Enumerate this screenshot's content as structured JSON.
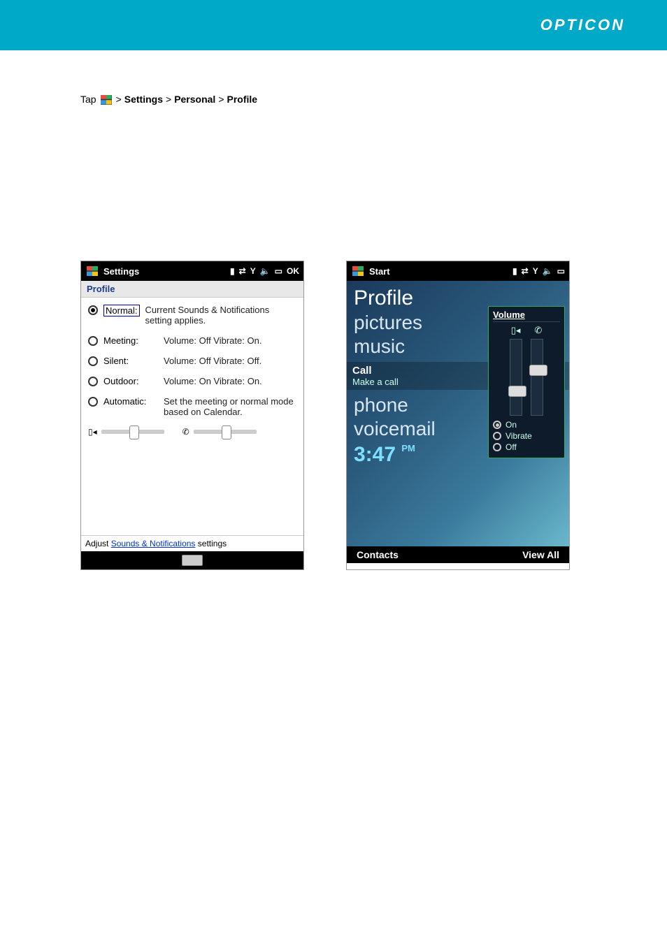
{
  "header": {
    "brand": "OPTICON"
  },
  "instruction": {
    "prefix": "Tap ",
    "arrow1": " > ",
    "settings": "Settings",
    "arrow2": " > ",
    "personal": "Personal",
    "arrow3": " > ",
    "profile": "Profile"
  },
  "phone1": {
    "status_title": "Settings",
    "section": "Profile",
    "options": [
      {
        "label": "Normal:",
        "desc": "Current Sounds & Notifications setting applies.",
        "selected": true,
        "boxed": true
      },
      {
        "label": "Meeting:",
        "desc": "Volume: Off Vibrate: On.",
        "selected": false
      },
      {
        "label": "Silent:",
        "desc": "Volume: Off Vibrate: Off.",
        "selected": false
      },
      {
        "label": "Outdoor:",
        "desc": "Volume: On Vibrate: On.",
        "selected": false
      },
      {
        "label": "Automatic:",
        "desc": "Set the meeting or normal mode based on Calendar.",
        "selected": false
      }
    ],
    "footer_pre": "Adjust ",
    "footer_link": "Sounds & Notifications",
    "footer_post": " settings"
  },
  "phone2": {
    "status_title": "Start",
    "links": {
      "profile": "Profile",
      "pictures": "pictures",
      "music": "music",
      "phone": "phone",
      "voicemail": "voicemail"
    },
    "mid": {
      "title": "Call",
      "sub": "Make a call"
    },
    "time": "3:47",
    "time_suffix": "PM",
    "soft_left": "Contacts",
    "soft_right": "View All",
    "volume": {
      "title": "Volume",
      "opts": [
        {
          "label": "On",
          "selected": true
        },
        {
          "label": "Vibrate",
          "selected": false
        },
        {
          "label": "Off",
          "selected": false
        }
      ]
    }
  }
}
